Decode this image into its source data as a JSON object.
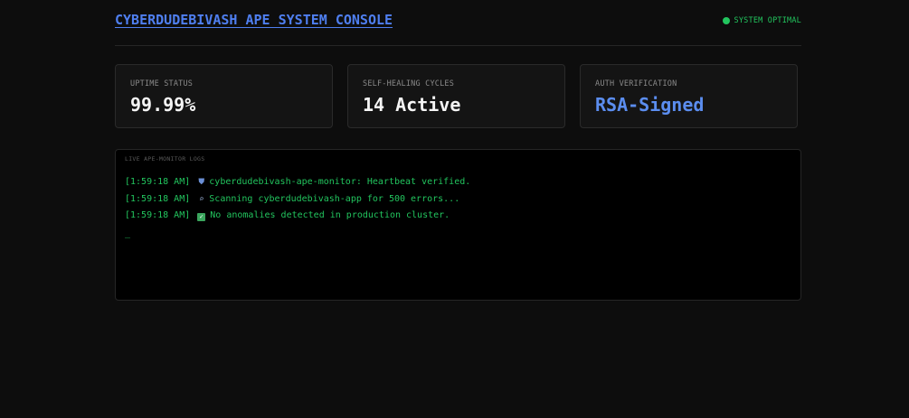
{
  "header": {
    "title": "CYBERDUDEBIVASH APE SYSTEM CONSOLE",
    "status_text": "SYSTEM OPTIMAL",
    "status_color": "#22c55e"
  },
  "cards": [
    {
      "label": "UPTIME STATUS",
      "value": "99.99%"
    },
    {
      "label": "SELF-HEALING CYCLES",
      "value": "14 Active"
    },
    {
      "label": "AUTH VERIFICATION",
      "value": "RSA-Signed",
      "accent": "#5b8def"
    }
  ],
  "terminal": {
    "label": "LIVE APE-MONITOR LOGS",
    "logs": [
      {
        "time": "[1:59:18 AM]",
        "icon": "shield-icon",
        "message": "cyberdudebivash-ape-monitor: Heartbeat verified."
      },
      {
        "time": "[1:59:18 AM]",
        "icon": "magnifier-icon",
        "message": "Scanning cyberdudebivash-app for 500 errors..."
      },
      {
        "time": "[1:59:18 AM]",
        "icon": "check-icon",
        "message": "No anomalies detected in production cluster."
      }
    ],
    "cursor": "_"
  }
}
